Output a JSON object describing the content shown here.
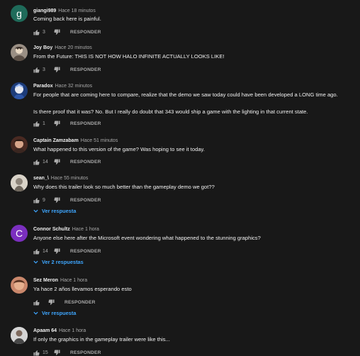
{
  "reply_label": "RESPONDER",
  "comments": [
    {
      "author": "giangi989",
      "time": "Hace 18 minutos",
      "text": [
        "Coming back here is painful."
      ],
      "likes": "3",
      "avatar": {
        "letter": "g",
        "color": "#1f6b5a"
      }
    },
    {
      "author": "Joy Boy",
      "time": "Hace 20 minutos",
      "text": [
        "From the Future: THIS IS NOT HOW HALO INFINITE ACTUALLY LOOKS LIKE!"
      ],
      "likes": "3",
      "avatar": {
        "color": "#9a8f84"
      }
    },
    {
      "author": "Paradox",
      "time": "Hace 32 minutos",
      "text": [
        "For people that are coming here to compare, realize that the demo we saw today could have been developed a LONG time ago.",
        "",
        "Is there proof that it was? No. But I really do doubt that 343 would ship a game with the lighting in that current state."
      ],
      "likes": "1",
      "avatar": {
        "color": "#1d3c7a"
      }
    },
    {
      "author": "Captain Zamzabam",
      "time": "Hace 51 minutos",
      "text": [
        "What happened to this version of the game? Was hoping to see it today."
      ],
      "likes": "14",
      "avatar": {
        "color": "#4a2a22"
      }
    },
    {
      "author": "sean_\\",
      "time": "Hace 55 minutos",
      "text": [
        "Why does this trailer look so much better than the gameplay demo we got??"
      ],
      "likes": "9",
      "replies_label": "Ver respuesta",
      "avatar": {
        "color": "#bdb6ad"
      }
    },
    {
      "author": "Connor Schultz",
      "time": "Hace 1 hora",
      "text": [
        "Anyone else here after the Microsoft event wondering what happened to the stunning graphics?"
      ],
      "likes": "14",
      "replies_label": "Ver 2 respuestas",
      "avatar": {
        "letter": "C",
        "color": "#7b2fbf"
      }
    },
    {
      "author": "Sez Meron",
      "time": "Hace 1 hora",
      "text": [
        "Ya hace 2 años llevamos esperando esto"
      ],
      "likes": "",
      "replies_label": "Ver respuesta",
      "avatar": {
        "color": "#c9876b"
      }
    },
    {
      "author": "Apaam 64",
      "time": "Hace 1 hora",
      "text": [
        "If only the graphics in the gameplay trailer were like this..."
      ],
      "likes": "15",
      "avatar": {
        "color": "#c7c7c7"
      }
    }
  ]
}
